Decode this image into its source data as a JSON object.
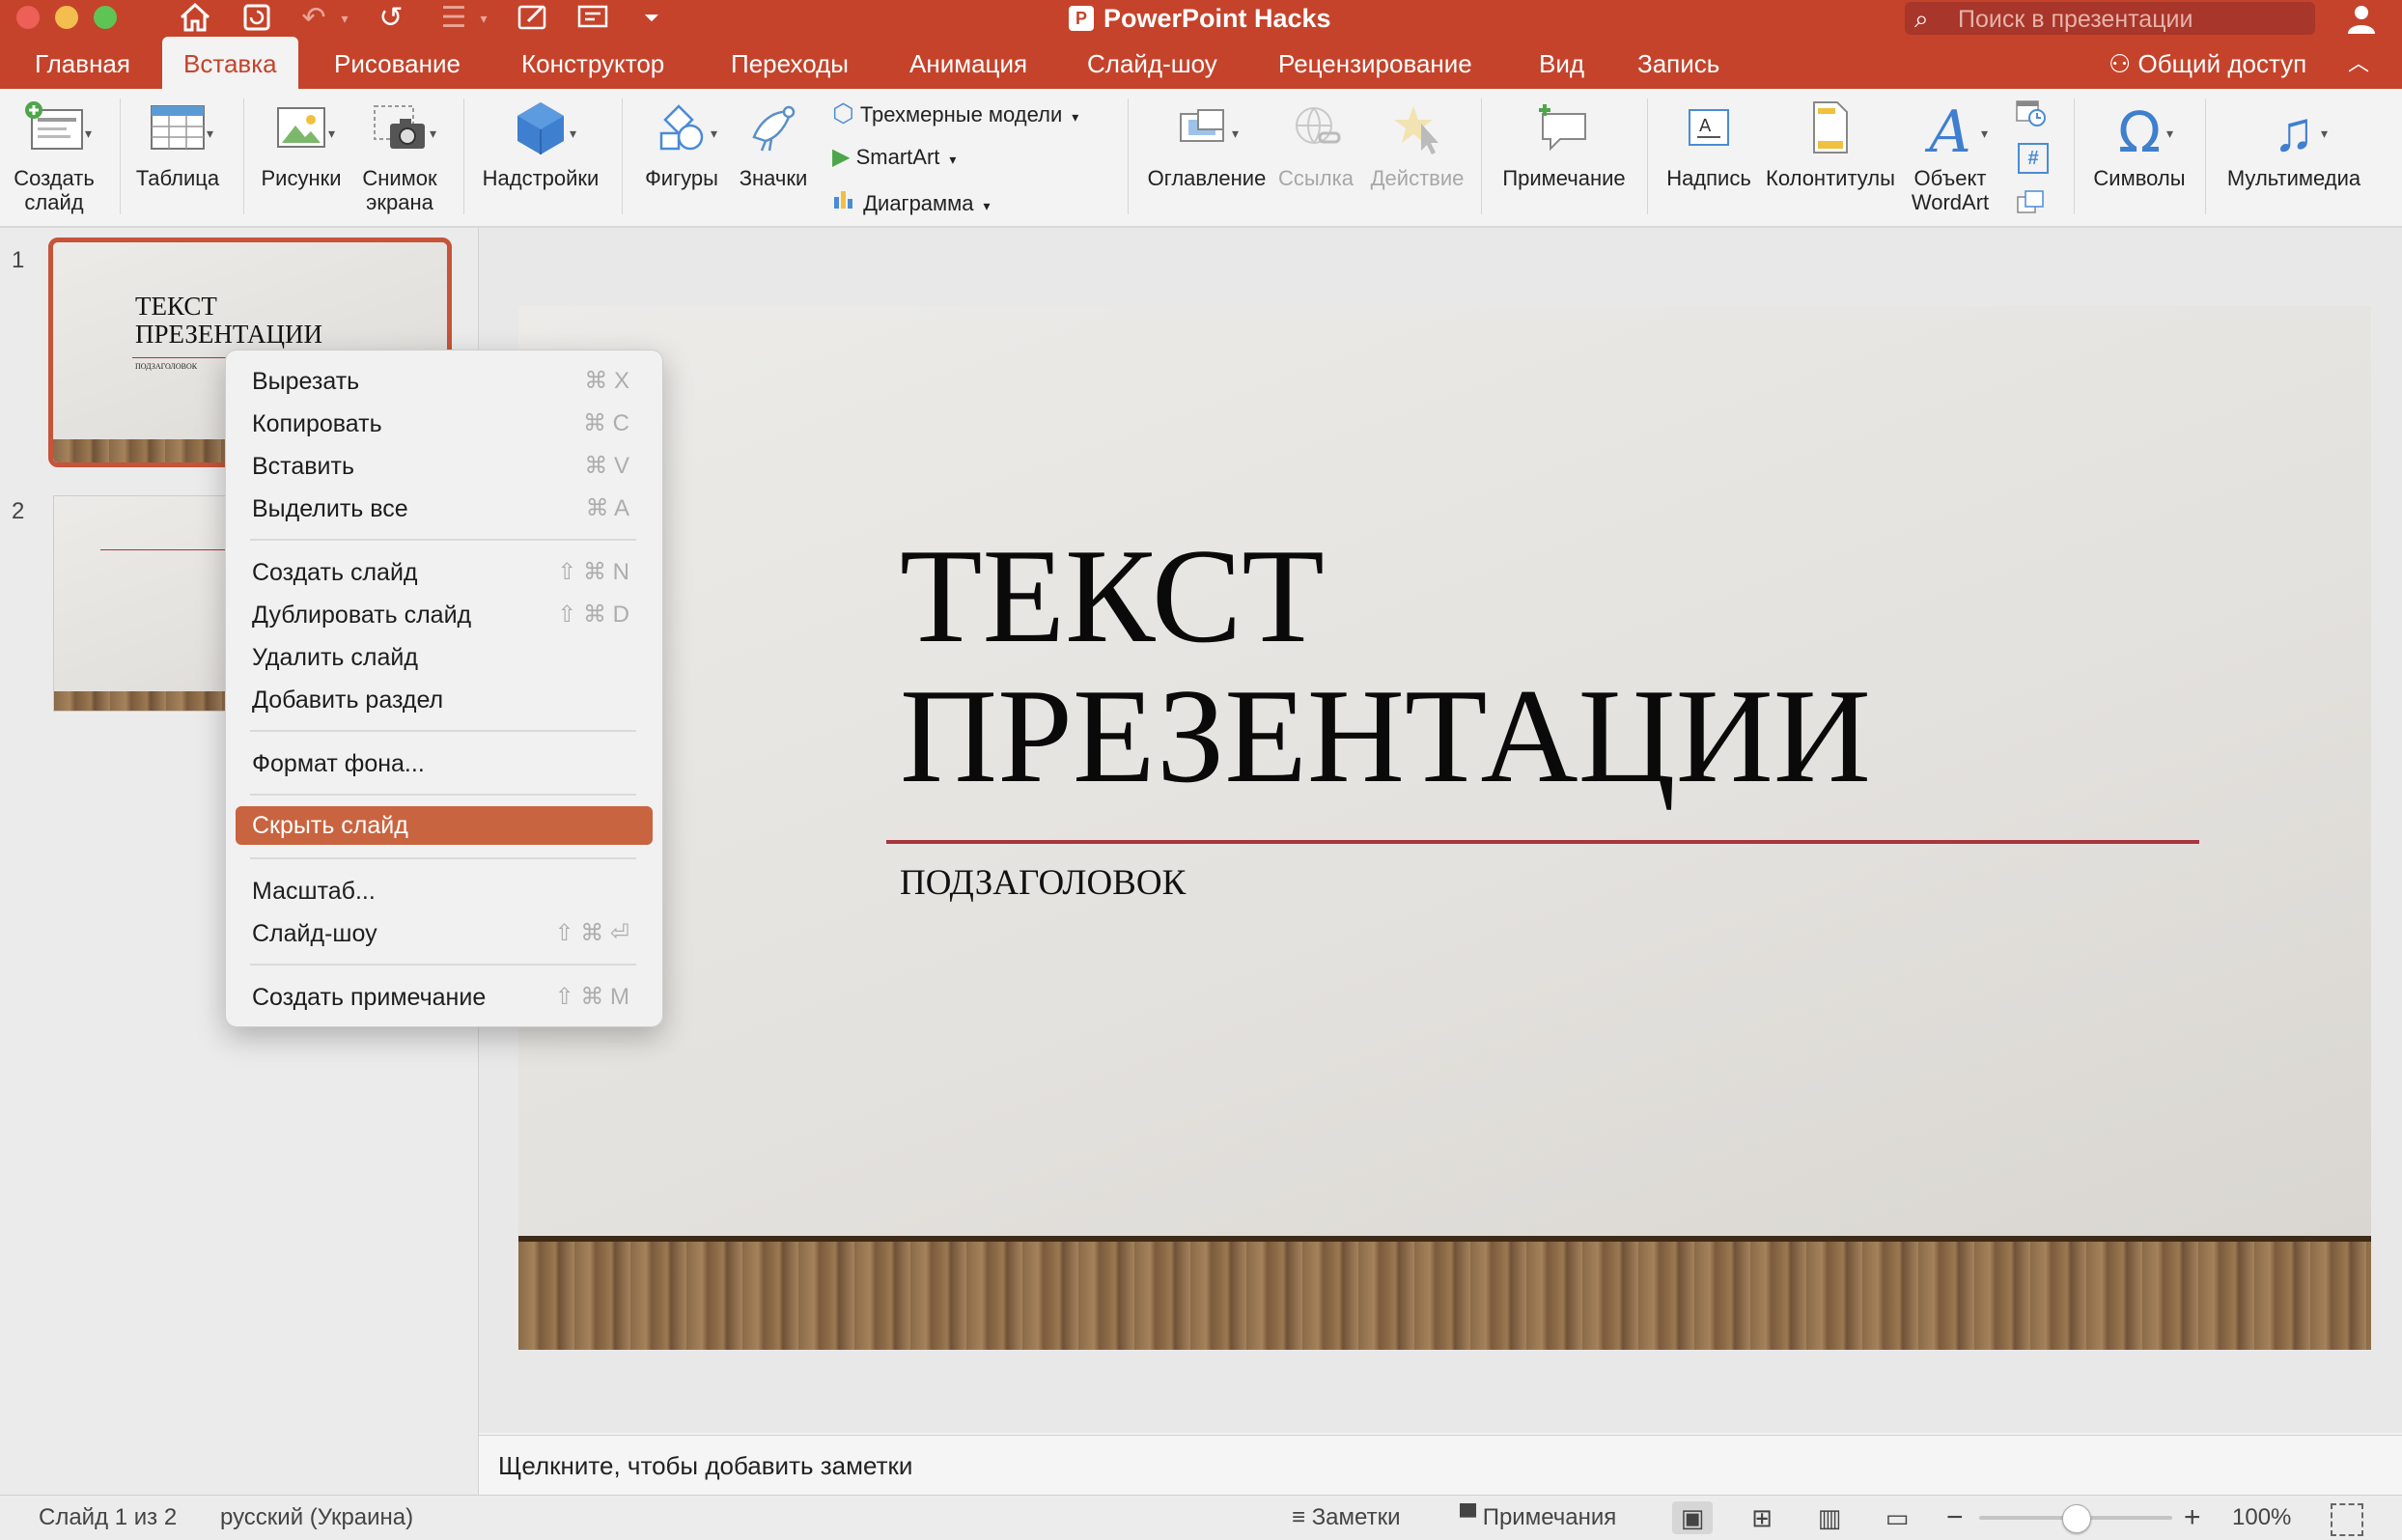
{
  "window": {
    "title": "PowerPoint Hacks",
    "search_placeholder": "Поиск в презентации"
  },
  "tabs": [
    "Главная",
    "Вставка",
    "Рисование",
    "Конструктор",
    "Переходы",
    "Анимация",
    "Слайд-шоу",
    "Рецензирование",
    "Вид",
    "Запись"
  ],
  "active_tab": "Вставка",
  "share_label": "Общий доступ",
  "ribbon": {
    "new_slide": [
      "Создать",
      "слайд"
    ],
    "table": "Таблица",
    "pictures": "Рисунки",
    "screenshot": [
      "Снимок",
      "экрана"
    ],
    "addins": "Надстройки",
    "shapes": "Фигуры",
    "icons": "Значки",
    "models_3d": "Трехмерные модели",
    "smartart": "SmartArt",
    "chart": "Диаграмма",
    "toc": "Оглавление",
    "link": "Ссылка",
    "action": "Действие",
    "comment": "Примечание",
    "textbox": "Надпись",
    "header_footer": "Колонтитулы",
    "wordart": [
      "Объект",
      "WordArt"
    ],
    "symbols": "Символы",
    "media": "Мультимедиа"
  },
  "thumbnails": [
    {
      "number": "1",
      "title": [
        "ТЕКСТ",
        "ПРЕЗЕНТАЦИИ"
      ],
      "subtitle": "ПОДЗАГОЛОВОК"
    },
    {
      "number": "2"
    }
  ],
  "slide": {
    "title_line1": "ТЕКСТ",
    "title_line2": "ПРЕЗЕНТАЦИИ",
    "subtitle": "ПОДЗАГОЛОВОК",
    "accent_color": "#a8353f"
  },
  "context_menu": {
    "items": [
      {
        "label": "Вырезать",
        "shortcut": "⌘ X"
      },
      {
        "label": "Копировать",
        "shortcut": "⌘ C"
      },
      {
        "label": "Вставить",
        "shortcut": "⌘ V"
      },
      {
        "label": "Выделить все",
        "shortcut": "⌘ A"
      },
      {
        "label": "Создать слайд",
        "shortcut": "⇧ ⌘ N"
      },
      {
        "label": "Дублировать слайд",
        "shortcut": "⇧ ⌘ D"
      },
      {
        "label": "Удалить слайд",
        "shortcut": ""
      },
      {
        "label": "Добавить раздел",
        "shortcut": ""
      },
      {
        "label": "Формат фона...",
        "shortcut": ""
      },
      {
        "label": "Скрыть слайд",
        "shortcut": "",
        "highlighted": true
      },
      {
        "label": "Масштаб...",
        "shortcut": ""
      },
      {
        "label": "Слайд-шоу",
        "shortcut": "⇧ ⌘ ⏎"
      },
      {
        "label": "Создать примечание",
        "shortcut": "⇧ ⌘ M"
      }
    ]
  },
  "notes_placeholder": "Щелкните, чтобы добавить заметки",
  "status": {
    "slide_counter": "Слайд 1 из 2",
    "language": "русский (Украина)",
    "notes_button": "Заметки",
    "comments_button": "Примечания",
    "zoom": "100%",
    "zoom_level": 0.5
  },
  "colors": {
    "accent": "#c5432b",
    "menu_highlight": "#c96440"
  }
}
